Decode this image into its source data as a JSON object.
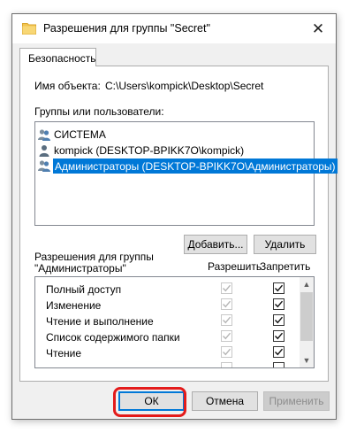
{
  "window": {
    "title": "Разрешения для группы \"Secret\"",
    "close_icon": "✕",
    "folder_color": "#f3c44f"
  },
  "tabs": [
    {
      "label": "Безопасность",
      "active": true
    }
  ],
  "object": {
    "label": "Имя объекта:",
    "path": "C:\\Users\\kompick\\Desktop\\Secret"
  },
  "groups": {
    "label": "Группы или пользователи:",
    "items": [
      {
        "name": "СИСТЕМА",
        "icon": "group-icon",
        "selected": false
      },
      {
        "name": "kompick (DESKTOP-BPIKK7O\\kompick)",
        "icon": "user-icon",
        "selected": false
      },
      {
        "name": "Администраторы (DESKTOP-BPIKK7O\\Администраторы)",
        "icon": "group-icon",
        "selected": true
      }
    ]
  },
  "buttons": {
    "add": "Добавить...",
    "remove": "Удалить",
    "ok": "ОК",
    "cancel": "Отмена",
    "apply": "Применить"
  },
  "permissions": {
    "title_line1": "Разрешения для группы",
    "title_line2": "\"Администраторы\"",
    "allow_header": "Разрешить",
    "deny_header": "Запретить",
    "items": [
      {
        "name": "Полный доступ",
        "allow": true,
        "deny": true
      },
      {
        "name": "Изменение",
        "allow": true,
        "deny": true
      },
      {
        "name": "Чтение и выполнение",
        "allow": true,
        "deny": true
      },
      {
        "name": "Список содержимого папки",
        "allow": true,
        "deny": true
      },
      {
        "name": "Чтение",
        "allow": true,
        "deny": true
      },
      {
        "name": "",
        "allow": true,
        "deny": true
      }
    ]
  },
  "colors": {
    "selection": "#0078d7",
    "highlight_annotation": "#e31b1b"
  }
}
